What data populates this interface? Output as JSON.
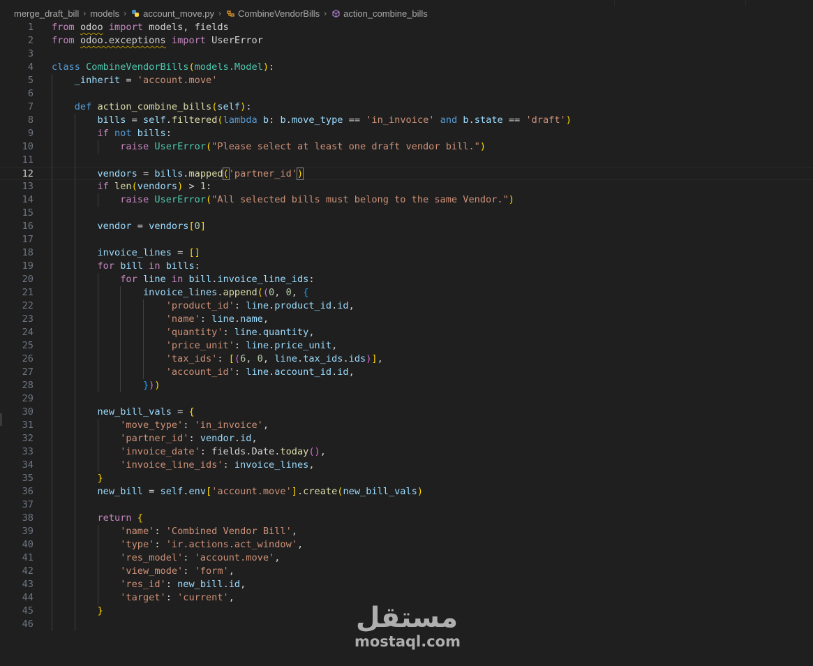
{
  "breadcrumb": {
    "items": [
      "merge_draft_bill",
      "models",
      "account_move.py",
      "CombineVendorBills",
      "action_combine_bills"
    ],
    "icons": [
      "none",
      "none",
      "python-file-icon",
      "class-icon",
      "method-icon"
    ]
  },
  "editor": {
    "active_line": 12,
    "last_line_number": "46"
  },
  "watermark": {
    "arabic": "مستقل",
    "latin": "mostaql.com"
  },
  "colors": {
    "background": "#1f1f1f",
    "keyword": "#569cd6",
    "control_keyword": "#c586c0",
    "function": "#dcdcaa",
    "class": "#4ec9b0",
    "variable": "#9cdcfe",
    "string": "#ce9178",
    "number": "#b5cea8"
  },
  "code_lines": [
    [
      [
        "kw2",
        "from"
      ],
      [
        "p",
        " "
      ],
      [
        "m",
        "odoo"
      ],
      [
        "p",
        " "
      ],
      [
        "kw2",
        "import"
      ],
      [
        "p",
        " models, fields"
      ]
    ],
    [
      [
        "kw2",
        "from"
      ],
      [
        "p",
        " "
      ],
      [
        "m",
        "odoo.exceptions"
      ],
      [
        "p",
        " "
      ],
      [
        "kw2",
        "import"
      ],
      [
        "p",
        " UserError"
      ]
    ],
    [],
    [
      [
        "kw",
        "class"
      ],
      [
        "p",
        " "
      ],
      [
        "cls",
        "CombineVendorBills"
      ],
      [
        "p1",
        "("
      ],
      [
        "cls",
        "models.Model"
      ],
      [
        "p1",
        ")"
      ],
      [
        "p",
        ":"
      ]
    ],
    [
      [
        "p",
        "    "
      ],
      [
        "var",
        "_inherit"
      ],
      [
        "p",
        " = "
      ],
      [
        "str",
        "'account.move'"
      ]
    ],
    [],
    [
      [
        "p",
        "    "
      ],
      [
        "kw",
        "def"
      ],
      [
        "p",
        " "
      ],
      [
        "fn",
        "action_combine_bills"
      ],
      [
        "p1",
        "("
      ],
      [
        "var",
        "self"
      ],
      [
        "p1",
        ")"
      ],
      [
        "p",
        ":"
      ]
    ],
    [
      [
        "p",
        "        "
      ],
      [
        "var",
        "bills"
      ],
      [
        "p",
        " = "
      ],
      [
        "var",
        "self"
      ],
      [
        "p",
        "."
      ],
      [
        "fn",
        "filtered"
      ],
      [
        "p1",
        "("
      ],
      [
        "kw",
        "lambda"
      ],
      [
        "p",
        " "
      ],
      [
        "var",
        "b"
      ],
      [
        "p",
        ": "
      ],
      [
        "var",
        "b"
      ],
      [
        "p",
        "."
      ],
      [
        "var",
        "move_type"
      ],
      [
        "p",
        " == "
      ],
      [
        "str",
        "'in_invoice'"
      ],
      [
        "p",
        " "
      ],
      [
        "kw",
        "and"
      ],
      [
        "p",
        " "
      ],
      [
        "var",
        "b"
      ],
      [
        "p",
        "."
      ],
      [
        "var",
        "state"
      ],
      [
        "p",
        " == "
      ],
      [
        "str",
        "'draft'"
      ],
      [
        "p1",
        ")"
      ]
    ],
    [
      [
        "p",
        "        "
      ],
      [
        "kw2",
        "if"
      ],
      [
        "p",
        " "
      ],
      [
        "kw",
        "not"
      ],
      [
        "p",
        " "
      ],
      [
        "var",
        "bills"
      ],
      [
        "p",
        ":"
      ]
    ],
    [
      [
        "p",
        "            "
      ],
      [
        "kw2",
        "raise"
      ],
      [
        "p",
        " "
      ],
      [
        "cls",
        "UserError"
      ],
      [
        "p1",
        "("
      ],
      [
        "str",
        "\"Please select at least one draft vendor bill.\""
      ],
      [
        "p1",
        ")"
      ]
    ],
    [],
    [
      [
        "p",
        "        "
      ],
      [
        "var",
        "vendors"
      ],
      [
        "p",
        " = "
      ],
      [
        "var",
        "bills"
      ],
      [
        "p",
        "."
      ],
      [
        "fn",
        "mapped"
      ],
      [
        "p1b",
        "("
      ],
      [
        "str",
        "'partner_id'"
      ],
      [
        "p1b",
        ")"
      ]
    ],
    [
      [
        "p",
        "        "
      ],
      [
        "kw2",
        "if"
      ],
      [
        "p",
        " "
      ],
      [
        "fn",
        "len"
      ],
      [
        "p1",
        "("
      ],
      [
        "var",
        "vendors"
      ],
      [
        "p1",
        ")"
      ],
      [
        "p",
        " > "
      ],
      [
        "num",
        "1"
      ],
      [
        "p",
        ":"
      ]
    ],
    [
      [
        "p",
        "            "
      ],
      [
        "kw2",
        "raise"
      ],
      [
        "p",
        " "
      ],
      [
        "cls",
        "UserError"
      ],
      [
        "p1",
        "("
      ],
      [
        "str",
        "\"All selected bills must belong to the same Vendor.\""
      ],
      [
        "p1",
        ")"
      ]
    ],
    [],
    [
      [
        "p",
        "        "
      ],
      [
        "var",
        "vendor"
      ],
      [
        "p",
        " = "
      ],
      [
        "var",
        "vendors"
      ],
      [
        "p1",
        "["
      ],
      [
        "num",
        "0"
      ],
      [
        "p1",
        "]"
      ]
    ],
    [],
    [
      [
        "p",
        "        "
      ],
      [
        "var",
        "invoice_lines"
      ],
      [
        "p",
        " = "
      ],
      [
        "p1",
        "[]"
      ]
    ],
    [
      [
        "p",
        "        "
      ],
      [
        "kw2",
        "for"
      ],
      [
        "p",
        " "
      ],
      [
        "var",
        "bill"
      ],
      [
        "p",
        " "
      ],
      [
        "kw2",
        "in"
      ],
      [
        "p",
        " "
      ],
      [
        "var",
        "bills"
      ],
      [
        "p",
        ":"
      ]
    ],
    [
      [
        "p",
        "            "
      ],
      [
        "kw2",
        "for"
      ],
      [
        "p",
        " "
      ],
      [
        "var",
        "line"
      ],
      [
        "p",
        " "
      ],
      [
        "kw2",
        "in"
      ],
      [
        "p",
        " "
      ],
      [
        "var",
        "bill"
      ],
      [
        "p",
        "."
      ],
      [
        "var",
        "invoice_line_ids"
      ],
      [
        "p",
        ":"
      ]
    ],
    [
      [
        "p",
        "                "
      ],
      [
        "var",
        "invoice_lines"
      ],
      [
        "p",
        "."
      ],
      [
        "fn",
        "append"
      ],
      [
        "p1",
        "("
      ],
      [
        "p2",
        "("
      ],
      [
        "num",
        "0"
      ],
      [
        "p",
        ", "
      ],
      [
        "num",
        "0"
      ],
      [
        "p",
        ", "
      ],
      [
        "p3",
        "{"
      ]
    ],
    [
      [
        "p",
        "                    "
      ],
      [
        "str",
        "'product_id'"
      ],
      [
        "p",
        ": "
      ],
      [
        "var",
        "line"
      ],
      [
        "p",
        "."
      ],
      [
        "var",
        "product_id"
      ],
      [
        "p",
        "."
      ],
      [
        "var",
        "id"
      ],
      [
        "p",
        ","
      ]
    ],
    [
      [
        "p",
        "                    "
      ],
      [
        "str",
        "'name'"
      ],
      [
        "p",
        ": "
      ],
      [
        "var",
        "line"
      ],
      [
        "p",
        "."
      ],
      [
        "var",
        "name"
      ],
      [
        "p",
        ","
      ]
    ],
    [
      [
        "p",
        "                    "
      ],
      [
        "str",
        "'quantity'"
      ],
      [
        "p",
        ": "
      ],
      [
        "var",
        "line"
      ],
      [
        "p",
        "."
      ],
      [
        "var",
        "quantity"
      ],
      [
        "p",
        ","
      ]
    ],
    [
      [
        "p",
        "                    "
      ],
      [
        "str",
        "'price_unit'"
      ],
      [
        "p",
        ": "
      ],
      [
        "var",
        "line"
      ],
      [
        "p",
        "."
      ],
      [
        "var",
        "price_unit"
      ],
      [
        "p",
        ","
      ]
    ],
    [
      [
        "p",
        "                    "
      ],
      [
        "str",
        "'tax_ids'"
      ],
      [
        "p",
        ": "
      ],
      [
        "p1",
        "["
      ],
      [
        "p2",
        "("
      ],
      [
        "num",
        "6"
      ],
      [
        "p",
        ", "
      ],
      [
        "num",
        "0"
      ],
      [
        "p",
        ", "
      ],
      [
        "var",
        "line"
      ],
      [
        "p",
        "."
      ],
      [
        "var",
        "tax_ids"
      ],
      [
        "p",
        "."
      ],
      [
        "var",
        "ids"
      ],
      [
        "p2",
        ")"
      ],
      [
        "p1",
        "]"
      ],
      [
        "p",
        ","
      ]
    ],
    [
      [
        "p",
        "                    "
      ],
      [
        "str",
        "'account_id'"
      ],
      [
        "p",
        ": "
      ],
      [
        "var",
        "line"
      ],
      [
        "p",
        "."
      ],
      [
        "var",
        "account_id"
      ],
      [
        "p",
        "."
      ],
      [
        "var",
        "id"
      ],
      [
        "p",
        ","
      ]
    ],
    [
      [
        "p",
        "                "
      ],
      [
        "p3",
        "}"
      ],
      [
        "p2",
        ")"
      ],
      [
        "p1",
        ")"
      ]
    ],
    [],
    [
      [
        "p",
        "        "
      ],
      [
        "var",
        "new_bill_vals"
      ],
      [
        "p",
        " = "
      ],
      [
        "p1",
        "{"
      ]
    ],
    [
      [
        "p",
        "            "
      ],
      [
        "str",
        "'move_type'"
      ],
      [
        "p",
        ": "
      ],
      [
        "str",
        "'in_invoice'"
      ],
      [
        "p",
        ","
      ]
    ],
    [
      [
        "p",
        "            "
      ],
      [
        "str",
        "'partner_id'"
      ],
      [
        "p",
        ": "
      ],
      [
        "var",
        "vendor"
      ],
      [
        "p",
        "."
      ],
      [
        "var",
        "id"
      ],
      [
        "p",
        ","
      ]
    ],
    [
      [
        "p",
        "            "
      ],
      [
        "str",
        "'invoice_date'"
      ],
      [
        "p",
        ": "
      ],
      [
        "p",
        "fields.Date."
      ],
      [
        "fn",
        "today"
      ],
      [
        "p2",
        "()"
      ],
      [
        "p",
        ","
      ]
    ],
    [
      [
        "p",
        "            "
      ],
      [
        "str",
        "'invoice_line_ids'"
      ],
      [
        "p",
        ": "
      ],
      [
        "var",
        "invoice_lines"
      ],
      [
        "p",
        ","
      ]
    ],
    [
      [
        "p",
        "        "
      ],
      [
        "p1",
        "}"
      ]
    ],
    [
      [
        "p",
        "        "
      ],
      [
        "var",
        "new_bill"
      ],
      [
        "p",
        " = "
      ],
      [
        "var",
        "self"
      ],
      [
        "p",
        "."
      ],
      [
        "var",
        "env"
      ],
      [
        "p1",
        "["
      ],
      [
        "str",
        "'account.move'"
      ],
      [
        "p1",
        "]"
      ],
      [
        "p",
        "."
      ],
      [
        "fn",
        "create"
      ],
      [
        "p1",
        "("
      ],
      [
        "var",
        "new_bill_vals"
      ],
      [
        "p1",
        ")"
      ]
    ],
    [],
    [
      [
        "p",
        "        "
      ],
      [
        "kw2",
        "return"
      ],
      [
        "p",
        " "
      ],
      [
        "p1",
        "{"
      ]
    ],
    [
      [
        "p",
        "            "
      ],
      [
        "str",
        "'name'"
      ],
      [
        "p",
        ": "
      ],
      [
        "str",
        "'Combined Vendor Bill'"
      ],
      [
        "p",
        ","
      ]
    ],
    [
      [
        "p",
        "            "
      ],
      [
        "str",
        "'type'"
      ],
      [
        "p",
        ": "
      ],
      [
        "str",
        "'ir.actions.act_window'"
      ],
      [
        "p",
        ","
      ]
    ],
    [
      [
        "p",
        "            "
      ],
      [
        "str",
        "'res_model'"
      ],
      [
        "p",
        ": "
      ],
      [
        "str",
        "'account.move'"
      ],
      [
        "p",
        ","
      ]
    ],
    [
      [
        "p",
        "            "
      ],
      [
        "str",
        "'view_mode'"
      ],
      [
        "p",
        ": "
      ],
      [
        "str",
        "'form'"
      ],
      [
        "p",
        ","
      ]
    ],
    [
      [
        "p",
        "            "
      ],
      [
        "str",
        "'res_id'"
      ],
      [
        "p",
        ": "
      ],
      [
        "var",
        "new_bill"
      ],
      [
        "p",
        "."
      ],
      [
        "var",
        "id"
      ],
      [
        "p",
        ","
      ]
    ],
    [
      [
        "p",
        "            "
      ],
      [
        "str",
        "'target'"
      ],
      [
        "p",
        ": "
      ],
      [
        "str",
        "'current'"
      ],
      [
        "p",
        ","
      ]
    ],
    [
      [
        "p",
        "        "
      ],
      [
        "p1",
        "}"
      ]
    ],
    []
  ]
}
